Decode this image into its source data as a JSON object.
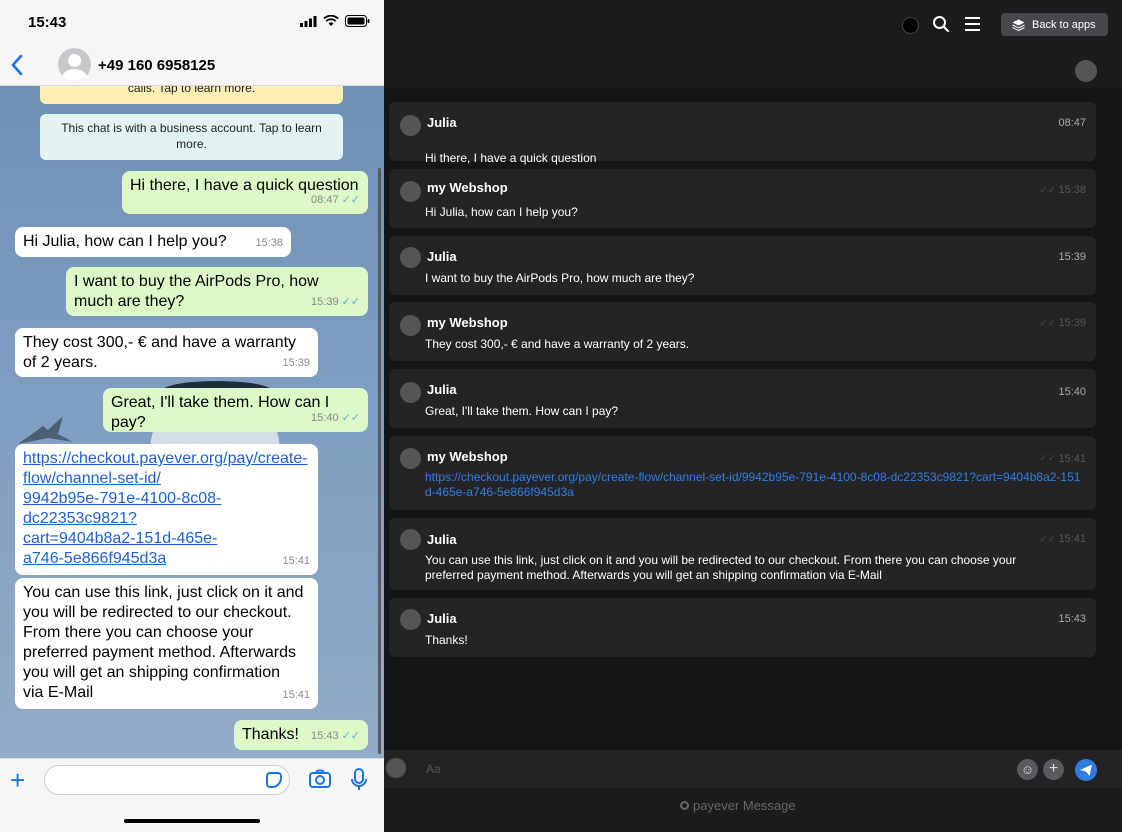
{
  "phone": {
    "status_time": "15:43",
    "contact_name": "+49 160 6958125",
    "notice_top": "calls. Tap to learn more.",
    "notice_business": "This chat is with a business account. Tap to learn more.",
    "messages": [
      {
        "dir": "out",
        "text": "Hi there, I have a quick question",
        "time": "08:47"
      },
      {
        "dir": "in",
        "text": "Hi Julia, how can I help you?",
        "time": "15:38"
      },
      {
        "dir": "out",
        "text": "I want to buy the AirPods Pro, how much are they?",
        "time": "15:39"
      },
      {
        "dir": "in",
        "text": "They cost 300,- € and have a warranty of 2 years.",
        "time": "15:39"
      },
      {
        "dir": "out",
        "text": "Great, I'll take them. How can I pay?",
        "time": "15:40"
      },
      {
        "dir": "in",
        "text": "https://checkout.payever.org/pay/create-flow/channel-set-id/9942b95e-791e-4100-8c08-dc22353c9821?cart=9404b8a2-151d-465e-a746-5e866f945d3a",
        "time": "15:41"
      },
      {
        "dir": "in",
        "text": "You can use this link, just click on it and you will be redirected to our checkout. From there you can choose your preferred payment method. Afterwards you will get an shipping confirmation via E-Mail",
        "time": "15:41"
      },
      {
        "dir": "out",
        "text": "Thanks!",
        "time": "15:43"
      }
    ],
    "link_lines": [
      "https://checkout.payever.org/pay/create-",
      "flow/channel-set-id/",
      "9942b95e-791e-4100-8c08-",
      "dc22353c9821?",
      "cart=9404b8a2-151d-465e-",
      "a746-5e866f945d3a"
    ]
  },
  "web": {
    "back_to_apps": "Back to apps",
    "composer_placeholder": "Aa",
    "footer_brand": "payever Message",
    "messages": [
      {
        "sender": "Julia",
        "text": "Hi there, I have a quick question",
        "time": "08:47"
      },
      {
        "sender": "my Webshop",
        "text": "Hi Julia, how can I help you?",
        "time": "15:38"
      },
      {
        "sender": "Julia",
        "text": "I want to buy the AirPods Pro, how much are they?",
        "time": "15:39"
      },
      {
        "sender": "my Webshop",
        "text": "They cost 300,- € and have a warranty of 2 years.",
        "time": "15:39"
      },
      {
        "sender": "Julia",
        "text": "Great, I'll take them. How can I pay?",
        "time": "15:40"
      },
      {
        "sender": "my Webshop",
        "text": "https://checkout.payever.org/pay/create-flow/channel-set-id/9942b95e-791e-4100-8c08-dc22353c9821?cart=9404b8a2-151d-465e-a746-5e866f945d3a",
        "time": "15:41"
      },
      {
        "sender": "Julia",
        "text": "You can use this link, just click on it and you will be redirected to our checkout. From there you can choose your preferred payment method. Afterwards you will get an shipping confirmation via E-Mail",
        "time": "15:41"
      },
      {
        "sender": "Julia",
        "text": "Thanks!",
        "time": "15:43"
      }
    ]
  },
  "colors": {
    "outgoing_bubble": "#dcf8c6",
    "incoming_bubble": "#ffffff",
    "link": "#2f7de1",
    "accent": "#1a73e8"
  },
  "icons": [
    "back-chevron-icon",
    "signal-icon",
    "wifi-icon",
    "battery-icon",
    "plus-icon",
    "sticker-icon",
    "camera-icon",
    "mic-icon",
    "search-icon",
    "menu-icon",
    "layers-icon",
    "emoji-icon",
    "send-icon"
  ]
}
